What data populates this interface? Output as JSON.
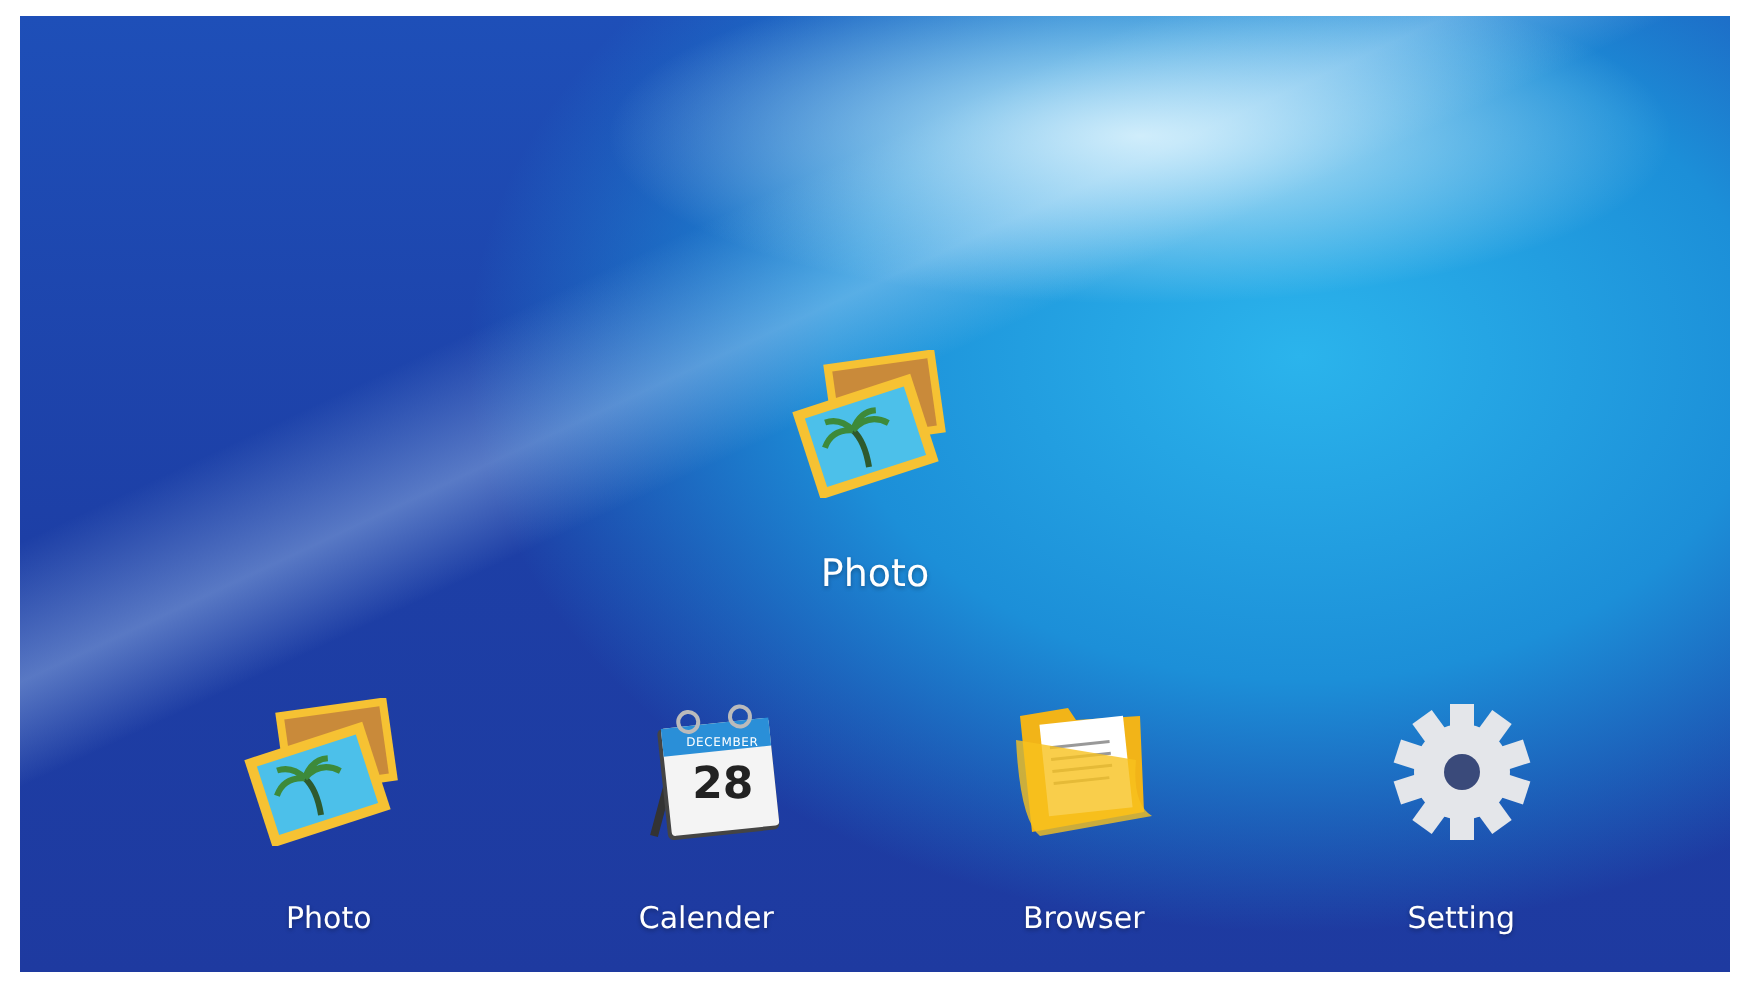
{
  "featured": {
    "kind": "photo",
    "label": "Photo"
  },
  "apps": [
    {
      "kind": "photo",
      "label": "Photo"
    },
    {
      "kind": "calendar",
      "label": "Calender",
      "month": "DECEMBER",
      "day": "28"
    },
    {
      "kind": "folder",
      "label": "Browser"
    },
    {
      "kind": "gear",
      "label": "Setting"
    }
  ]
}
